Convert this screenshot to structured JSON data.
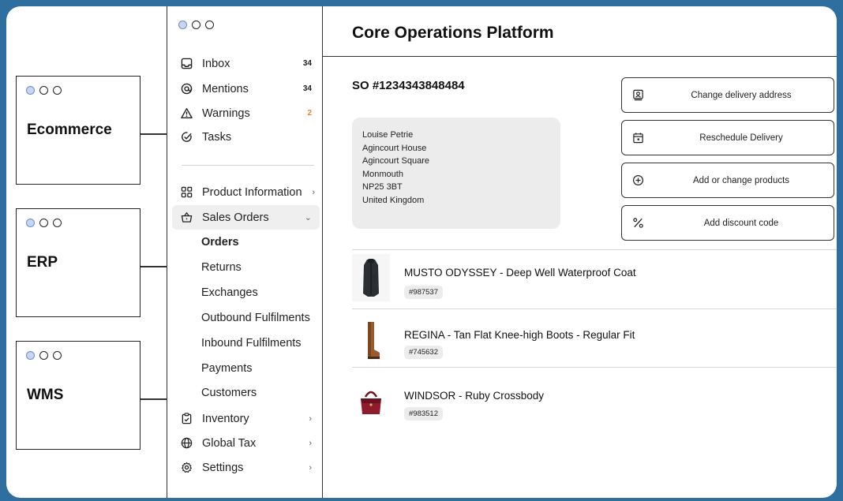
{
  "external_systems": [
    {
      "label": "Ecommerce"
    },
    {
      "label": "ERP"
    },
    {
      "label": "WMS"
    }
  ],
  "sidebar": {
    "top_items": [
      {
        "label": "Inbox",
        "icon": "inbox-icon",
        "count": "34"
      },
      {
        "label": "Mentions",
        "icon": "at-sign-icon",
        "count": "34"
      },
      {
        "label": "Warnings",
        "icon": "warning-triangle-icon",
        "count": "2"
      },
      {
        "label": "Tasks",
        "icon": "tasks-check-icon",
        "count": ""
      }
    ],
    "product_information": {
      "label": "Product Information",
      "icon": "grid-icon",
      "chevron": "›"
    },
    "sales_orders": {
      "label": "Sales Orders",
      "icon": "basket-icon",
      "chevron": "⌄"
    },
    "sub_items": [
      "Orders",
      "Returns",
      "Exchanges",
      "Outbound Fulfilments",
      "Inbound Fulfilments",
      "Payments",
      "Customers"
    ],
    "bottom_items": [
      {
        "label": "Inventory",
        "icon": "clipboard-icon",
        "chevron": "›"
      },
      {
        "label": "Global Tax",
        "icon": "globe-icon",
        "chevron": "›"
      },
      {
        "label": "Settings",
        "icon": "gear-icon",
        "chevron": "›"
      }
    ]
  },
  "header": {
    "title": "Core Operations Platform"
  },
  "order": {
    "number": "SO #1234343848484",
    "address_lines": [
      "Louise Petrie",
      "Agincourt House",
      "Agincourt Square",
      "Monmouth",
      "NP25 3BT",
      "United Kingdom"
    ]
  },
  "actions": [
    {
      "label": "Change delivery address",
      "icon": "address-icon"
    },
    {
      "label": "Reschedule Delivery",
      "icon": "calendar-icon"
    },
    {
      "label": "Add or change products",
      "icon": "plus-circle-icon"
    },
    {
      "label": "Add discount code",
      "icon": "percent-icon"
    }
  ],
  "products": [
    {
      "name": "MUSTO ODYSSEY - Deep Well Waterproof Coat",
      "sku": "#987537",
      "image": "coat-image"
    },
    {
      "name": "REGINA - Tan Flat Knee-high Boots - Regular Fit",
      "sku": "#745632",
      "image": "boots-image"
    },
    {
      "name": "WINDSOR - Ruby Crossbody",
      "sku": "#983512",
      "image": "bag-image"
    }
  ],
  "colors": {
    "frame": "#2f6f9f",
    "warning": "#e08a2e",
    "dot_active": "#c8d6f2"
  }
}
